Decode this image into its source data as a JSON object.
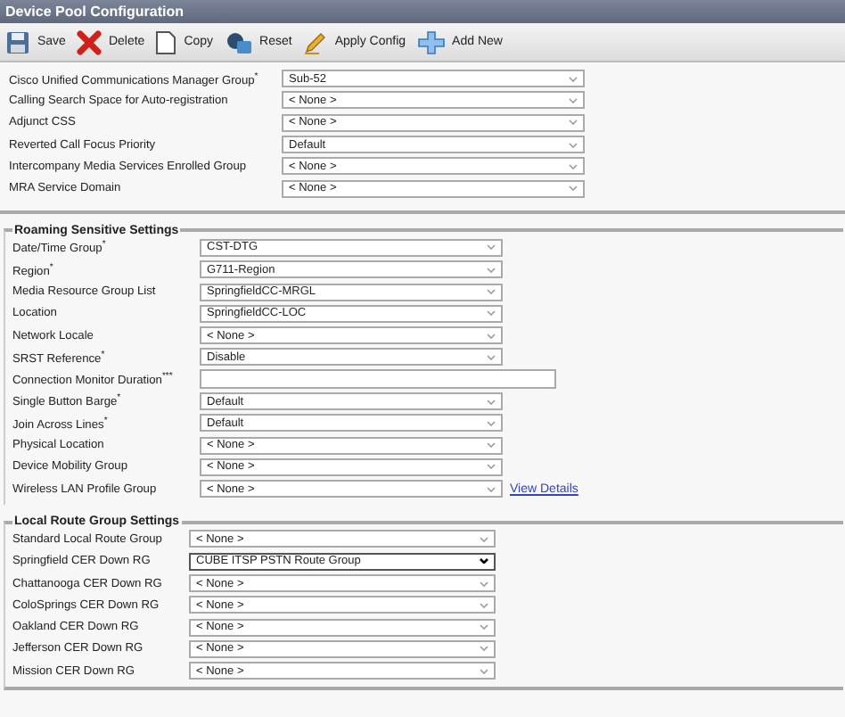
{
  "window": {
    "title": "Device Pool Configuration"
  },
  "toolbar": [
    {
      "kind": "save",
      "label": "Save"
    },
    {
      "kind": "delete",
      "label": "Delete"
    },
    {
      "kind": "copy",
      "label": "Copy"
    },
    {
      "kind": "reset",
      "label": "Reset"
    },
    {
      "kind": "apply",
      "label": "Apply Config"
    },
    {
      "kind": "add",
      "label": "Add New"
    }
  ],
  "general": {
    "rows": [
      {
        "label": "Cisco Unified Communications Manager Group$^{*}$",
        "kind": "select",
        "value": "Sub-52"
      },
      {
        "label": "Calling Search Space for Auto-registration",
        "kind": "select",
        "value": "< None >"
      },
      {
        "label": "Adjunct CSS",
        "kind": "select",
        "value": "< None >"
      },
      {
        "label": "Reverted Call Focus Priority",
        "kind": "select",
        "value": "Default"
      },
      {
        "label": "Intercompany Media Services Enrolled Group",
        "kind": "select",
        "value": "< None >"
      },
      {
        "label": "MRA Service Domain",
        "kind": "select",
        "value": "< None >"
      }
    ]
  },
  "roaming": {
    "title": "Roaming Sensitive Settings",
    "rows": [
      {
        "label": "Date/Time Group$^{*}$",
        "kind": "select",
        "value": "CST-DTG"
      },
      {
        "label": "Region$^{*}$",
        "kind": "select",
        "value": "G711-Region"
      },
      {
        "label": "Media Resource Group List",
        "kind": "select",
        "value": "SpringfieldCC-MRGL"
      },
      {
        "label": "Location",
        "kind": "select",
        "value": "SpringfieldCC-LOC"
      },
      {
        "label": "Network Locale",
        "kind": "select",
        "value": "< None >"
      },
      {
        "label": "SRST Reference$^{*}$",
        "kind": "select",
        "value": "Disable"
      },
      {
        "label": "Connection Monitor Duration$^{***}$",
        "kind": "text"
      },
      {
        "label": "Single Button Barge$^{*}$",
        "kind": "select",
        "value": "Default"
      },
      {
        "label": "Join Across Lines$^{*}$",
        "kind": "select",
        "value": "Default"
      },
      {
        "label": "Physical Location",
        "kind": "select",
        "value": "< None >"
      },
      {
        "label": "Device Mobility Group",
        "kind": "select",
        "value": "< None >"
      },
      {
        "label": "Wireless LAN Profile Group",
        "kind": "select",
        "value": "< None >",
        "link": "View Details"
      }
    ]
  },
  "local_route": {
    "title": "Local Route Group Settings",
    "rows": [
      {
        "label": "Standard Local Route Group",
        "kind": "select",
        "value": "< None >",
        "focused": false
      },
      {
        "label": "Springfield CER Down RG",
        "kind": "select",
        "value": "CUBE ITSP PSTN Route Group",
        "focused": true
      },
      {
        "label": "Chattanooga CER Down RG",
        "kind": "select",
        "value": "< None >",
        "focused": false
      },
      {
        "label": "ColoSprings CER Down RG",
        "kind": "select",
        "value": "< None >",
        "focused": false
      },
      {
        "label": "Oakland CER Down RG",
        "kind": "select",
        "value": "< None >",
        "focused": false
      },
      {
        "label": "Jefferson CER Down RG",
        "kind": "select",
        "value": "< None >",
        "focused": false
      },
      {
        "label": "Mission CER Down RG",
        "kind": "select",
        "value": "< None >",
        "focused": false
      }
    ]
  }
}
